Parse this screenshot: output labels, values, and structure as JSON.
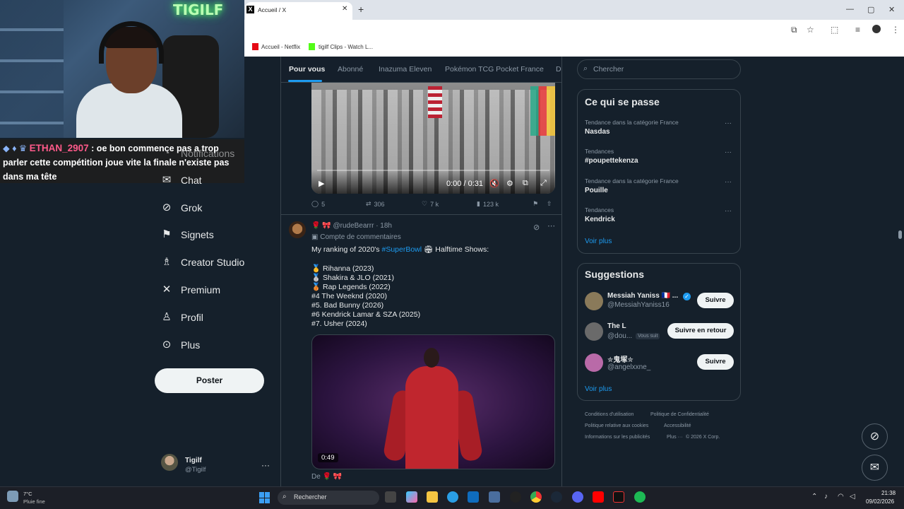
{
  "stream": {
    "neon_sign": "TIGILF",
    "chat": {
      "badges": "◆ ♦ ♛",
      "username": "ETHAN_2907",
      "message": ": oe bon commence pas a trop parler cette compétition joue vite la finale n'existe pas dans ma tête"
    }
  },
  "browser": {
    "tab_title": "Accueil / X",
    "tab_favicon": "X",
    "bookmarks": [
      {
        "label": "Accueil - Netflix",
        "color": "#e50914"
      },
      {
        "label": "tigilf Clips - Watch L...",
        "color": "#53fc18"
      }
    ],
    "window_controls": [
      "—",
      "▢",
      "✕"
    ]
  },
  "nav": {
    "items": [
      {
        "label": "Notifications",
        "icon": "bell-icon",
        "glyph": "🔔"
      },
      {
        "label": "Chat",
        "icon": "mail-icon",
        "glyph": "✉"
      },
      {
        "label": "Grok",
        "icon": "grok-icon",
        "glyph": "⊘"
      },
      {
        "label": "Signets",
        "icon": "bookmark-icon",
        "glyph": "🔖"
      },
      {
        "label": "Creator Studio",
        "icon": "creator-studio-icon",
        "glyph": "♗"
      },
      {
        "label": "Premium",
        "icon": "x-logo-icon",
        "glyph": "𝕏"
      },
      {
        "label": "Profil",
        "icon": "person-icon",
        "glyph": "👤"
      },
      {
        "label": "Plus",
        "icon": "more-circle-icon",
        "glyph": "⋯"
      }
    ],
    "post_label": "Poster",
    "account": {
      "name": "Tigilf",
      "handle": "@Tigilf"
    }
  },
  "feed": {
    "tabs": [
      "Pour vous",
      "Abonné",
      "Inazuma Eleven",
      "Pokémon TCG Pocket France",
      "De"
    ],
    "active_tab": 0,
    "tweet1": {
      "video_time": "0:00 / 0:31",
      "replies": "5",
      "reposts": "306",
      "likes": "7 k",
      "views": "123 k"
    },
    "tweet2": {
      "author_emojis": "🌹 🎀",
      "handle": "@rudeBearrr · 18h",
      "context": "Compte de commentaires",
      "lines": [
        {
          "before": "My ranking of 2020's ",
          "hashtag": "#SuperBowl",
          "after": " 🏟 Halftime Shows:"
        },
        {
          "before": "",
          "hashtag": "",
          "after": ""
        },
        {
          "before": "🥇 Rihanna (2023)",
          "hashtag": "",
          "after": ""
        },
        {
          "before": "🥈 Shakira & JLO (2021)",
          "hashtag": "",
          "after": ""
        },
        {
          "before": "🥉 Rap Legends (2022)",
          "hashtag": "",
          "after": ""
        },
        {
          "before": "#4 The Weeknd (2020)",
          "hashtag": "",
          "after": ""
        },
        {
          "before": "#5. Bad Bunny (2026)",
          "hashtag": "",
          "after": ""
        },
        {
          "before": "#6 Kendrick Lamar & SZA (2025)",
          "hashtag": "",
          "after": ""
        },
        {
          "before": "#7. Usher (2024)",
          "hashtag": "",
          "after": ""
        }
      ],
      "video_duration": "0:49"
    },
    "tweet3_start": "De 🌹 🎀"
  },
  "sidebar": {
    "search_placeholder": "Chercher",
    "trends_title": "Ce qui se passe",
    "trends": [
      {
        "context": "Tendance dans la catégorie France",
        "name": "Nasdas"
      },
      {
        "context": "Tendances",
        "name": "#poupettekenza"
      },
      {
        "context": "Tendance dans la catégorie France",
        "name": "Pouille"
      },
      {
        "context": "Tendances",
        "name": "Kendrick"
      }
    ],
    "show_more": "Voir plus",
    "suggestions_title": "Suggestions",
    "suggestions": [
      {
        "name": "Messiah Yaniss 🇫🇷 ...",
        "handle": "@MessiahYaniss16",
        "button": "Suivre",
        "follows_you": "",
        "avatar_color": "#8a7a5a"
      },
      {
        "name": "The L",
        "handle": "@dou...",
        "button": "Suivre en retour",
        "follows_you": "Vous suit",
        "avatar_color": "#6a6a6a"
      },
      {
        "name": "✮鬼塚✮",
        "handle": "@angelxxne_",
        "button": "Suivre",
        "follows_you": "",
        "avatar_color": "#b96aa8"
      }
    ],
    "footer": {
      "line1": [
        "Conditions d'utilisation",
        "Politique de Confidentialité"
      ],
      "line2": [
        "Politique relative aux cookies",
        "Accessibilité"
      ],
      "line3": [
        "Informations sur les publicités",
        "Plus ···",
        "© 2026 X Corp."
      ]
    }
  },
  "taskbar": {
    "weather_temp": "7°C",
    "weather_desc": "Pluie fine",
    "search_text": "Rechercher",
    "time": "21:38",
    "date": "09/02/2026"
  }
}
